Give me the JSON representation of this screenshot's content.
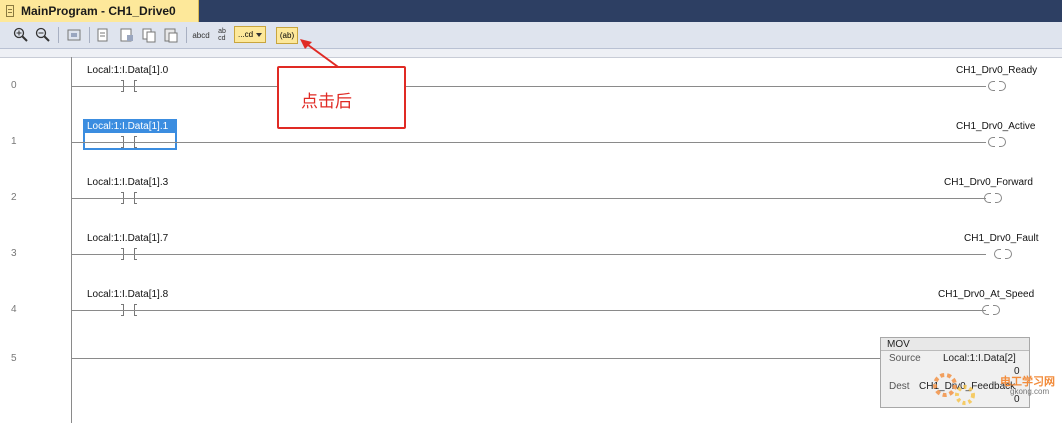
{
  "tab": {
    "title": "MainProgram - CH1_Drive0"
  },
  "toolbar": {
    "buttons": [
      "zoom-in",
      "zoom-out",
      "fit",
      "branch",
      "rung-comment",
      "copy",
      "paste",
      "abcd",
      "ab-cd"
    ],
    "abcd_label": "abcd",
    "abcd2_label": "ab\ncd",
    "combo_value": "...cd",
    "tag_button_label": "(ab)"
  },
  "rungs": [
    {
      "number": "0",
      "contact": "Local:1:I.Data[1].0",
      "coil": "CH1_Drv0_Ready"
    },
    {
      "number": "1",
      "contact": "Local:1:I.Data[1].1",
      "coil": "CH1_Drv0_Active"
    },
    {
      "number": "2",
      "contact": "Local:1:I.Data[1].3",
      "coil": "CH1_Drv0_Forward"
    },
    {
      "number": "3",
      "contact": "Local:1:I.Data[1].7",
      "coil": "CH1_Drv0_Fault"
    },
    {
      "number": "4",
      "contact": "Local:1:I.Data[1].8",
      "coil": "CH1_Drv0_At_Speed"
    },
    {
      "number": "5"
    }
  ],
  "callout": {
    "text": "点击后"
  },
  "mov": {
    "title": "MOV",
    "source_label": "Source",
    "source_value": "Local:1:I.Data[2]",
    "source_sub": "0",
    "dest_label": "Dest",
    "dest_value": "CH1_Drv0_Feedback",
    "dest_sub": "0"
  },
  "watermark": {
    "text": "电工学习网",
    "url": "gkong.com"
  },
  "colors": {
    "tab": "#fde89a",
    "titlebar": "#2d3f63",
    "selection": "#3b8de0",
    "callout": "#e02a24"
  }
}
